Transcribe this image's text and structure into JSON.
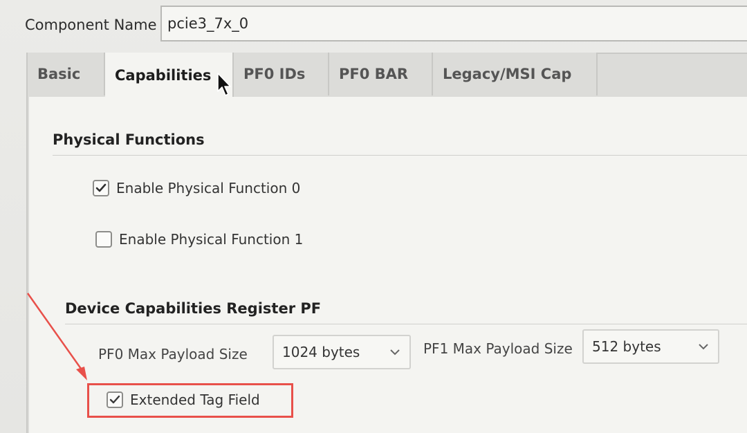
{
  "component": {
    "label": "Component Name",
    "value": "pcie3_7x_0"
  },
  "tabs": [
    {
      "label": "Basic",
      "active": false
    },
    {
      "label": "Capabilities",
      "active": true
    },
    {
      "label": "PF0 IDs",
      "active": false
    },
    {
      "label": "PF0 BAR",
      "active": false
    },
    {
      "label": "Legacy/MSI Cap",
      "active": false
    }
  ],
  "physical_functions": {
    "title": "Physical Functions",
    "pf0": {
      "label": "Enable Physical Function 0",
      "checked": true
    },
    "pf1": {
      "label": "Enable Physical Function 1",
      "checked": false
    }
  },
  "device_caps": {
    "title": "Device Capabilities Register PF",
    "pf0_payload": {
      "label": "PF0 Max Payload Size",
      "value": "1024 bytes"
    },
    "pf1_payload": {
      "label": "PF1 Max Payload Size",
      "value": "512 bytes"
    },
    "extended_tag": {
      "label": "Extended Tag Field",
      "checked": true
    }
  },
  "colors": {
    "annotation": "#e8504a"
  },
  "icons": {
    "cursor": "mouse-pointer-icon",
    "check": "check-icon",
    "dropdown": "chevron-down-icon"
  }
}
